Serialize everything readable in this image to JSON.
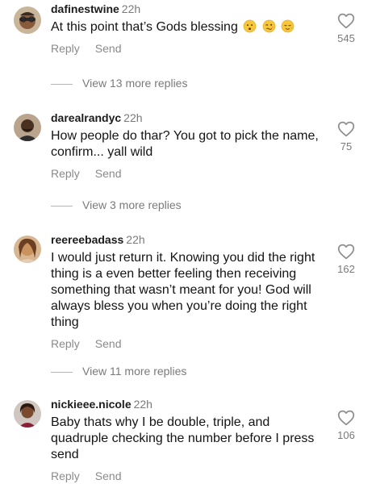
{
  "comments": [
    {
      "username": "dafinestwine",
      "time": "22h",
      "text": "At this point that’s Gods blessing",
      "emojis": [
        "hushed-face-emoji",
        "woozy-face-emoji",
        "relieved-face-emoji"
      ],
      "likes": "545",
      "reply_label": "Reply",
      "send_label": "Send",
      "view_replies": "View 13 more replies"
    },
    {
      "username": "darealrandyc",
      "time": "22h",
      "text": "How people do thar? You got to pick the name, confirm... yall wild",
      "likes": "75",
      "reply_label": "Reply",
      "send_label": "Send",
      "view_replies": "View 3 more replies"
    },
    {
      "username": "reereebadass",
      "time": "22h",
      "text": "I would just return it. Knowing you did the right thing is a even better feeling then receiving something that wasn’t meant for you! God will always bless you when you’re doing the right thing",
      "likes": "162",
      "reply_label": "Reply",
      "send_label": "Send",
      "view_replies": "View 11 more replies"
    },
    {
      "username": "nickieee.nicole",
      "time": "22h",
      "text": "Baby thats why I be double, triple, and quadruple checking the number before I press send",
      "likes": "106",
      "reply_label": "Reply",
      "send_label": "Send"
    }
  ],
  "colors": {
    "text": "#141414",
    "secondary": "#7a7a7a",
    "heart_stroke": "#8e8e8e"
  }
}
